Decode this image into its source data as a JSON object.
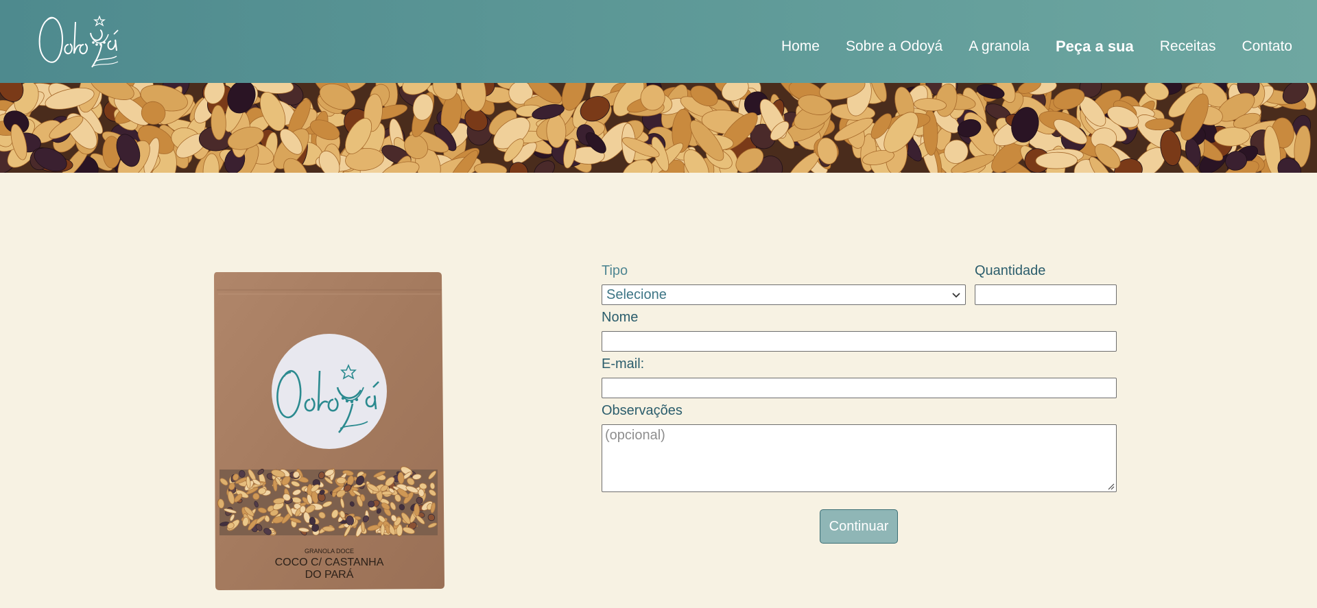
{
  "brand": {
    "logo_text": "Odoyá"
  },
  "nav": {
    "items": [
      {
        "label": "Home",
        "active": false
      },
      {
        "label": "Sobre a Odoyá",
        "active": false
      },
      {
        "label": "A granola",
        "active": false
      },
      {
        "label": "Peça a sua",
        "active": true
      },
      {
        "label": "Receitas",
        "active": false
      },
      {
        "label": "Contato",
        "active": false
      }
    ]
  },
  "product": {
    "sticker_text": "Odoyá",
    "label_line1": "GRANOLA DOCE",
    "label_line2": "COCO C/ CASTANHA",
    "label_line3": "DO PARÁ"
  },
  "form": {
    "tipo_label": "Tipo",
    "tipo_value": "Selecione",
    "quantidade_label": "Quantidade",
    "quantidade_value": "",
    "nome_label": "Nome",
    "nome_value": "",
    "email_label": "E-mail:",
    "email_value": "",
    "obs_label": "Observações",
    "obs_placeholder": "(opcional)",
    "submit_label": "Continuar"
  },
  "colors": {
    "header": "#5f9a98",
    "page_background": "#f7f2e3",
    "label_text": "#2b5d6c",
    "button": "#8fb6b6",
    "logo_teal": "#2b8a8f"
  },
  "icons": {
    "select": "chevron-down-icon",
    "textarea": "resize-handle-icon"
  }
}
